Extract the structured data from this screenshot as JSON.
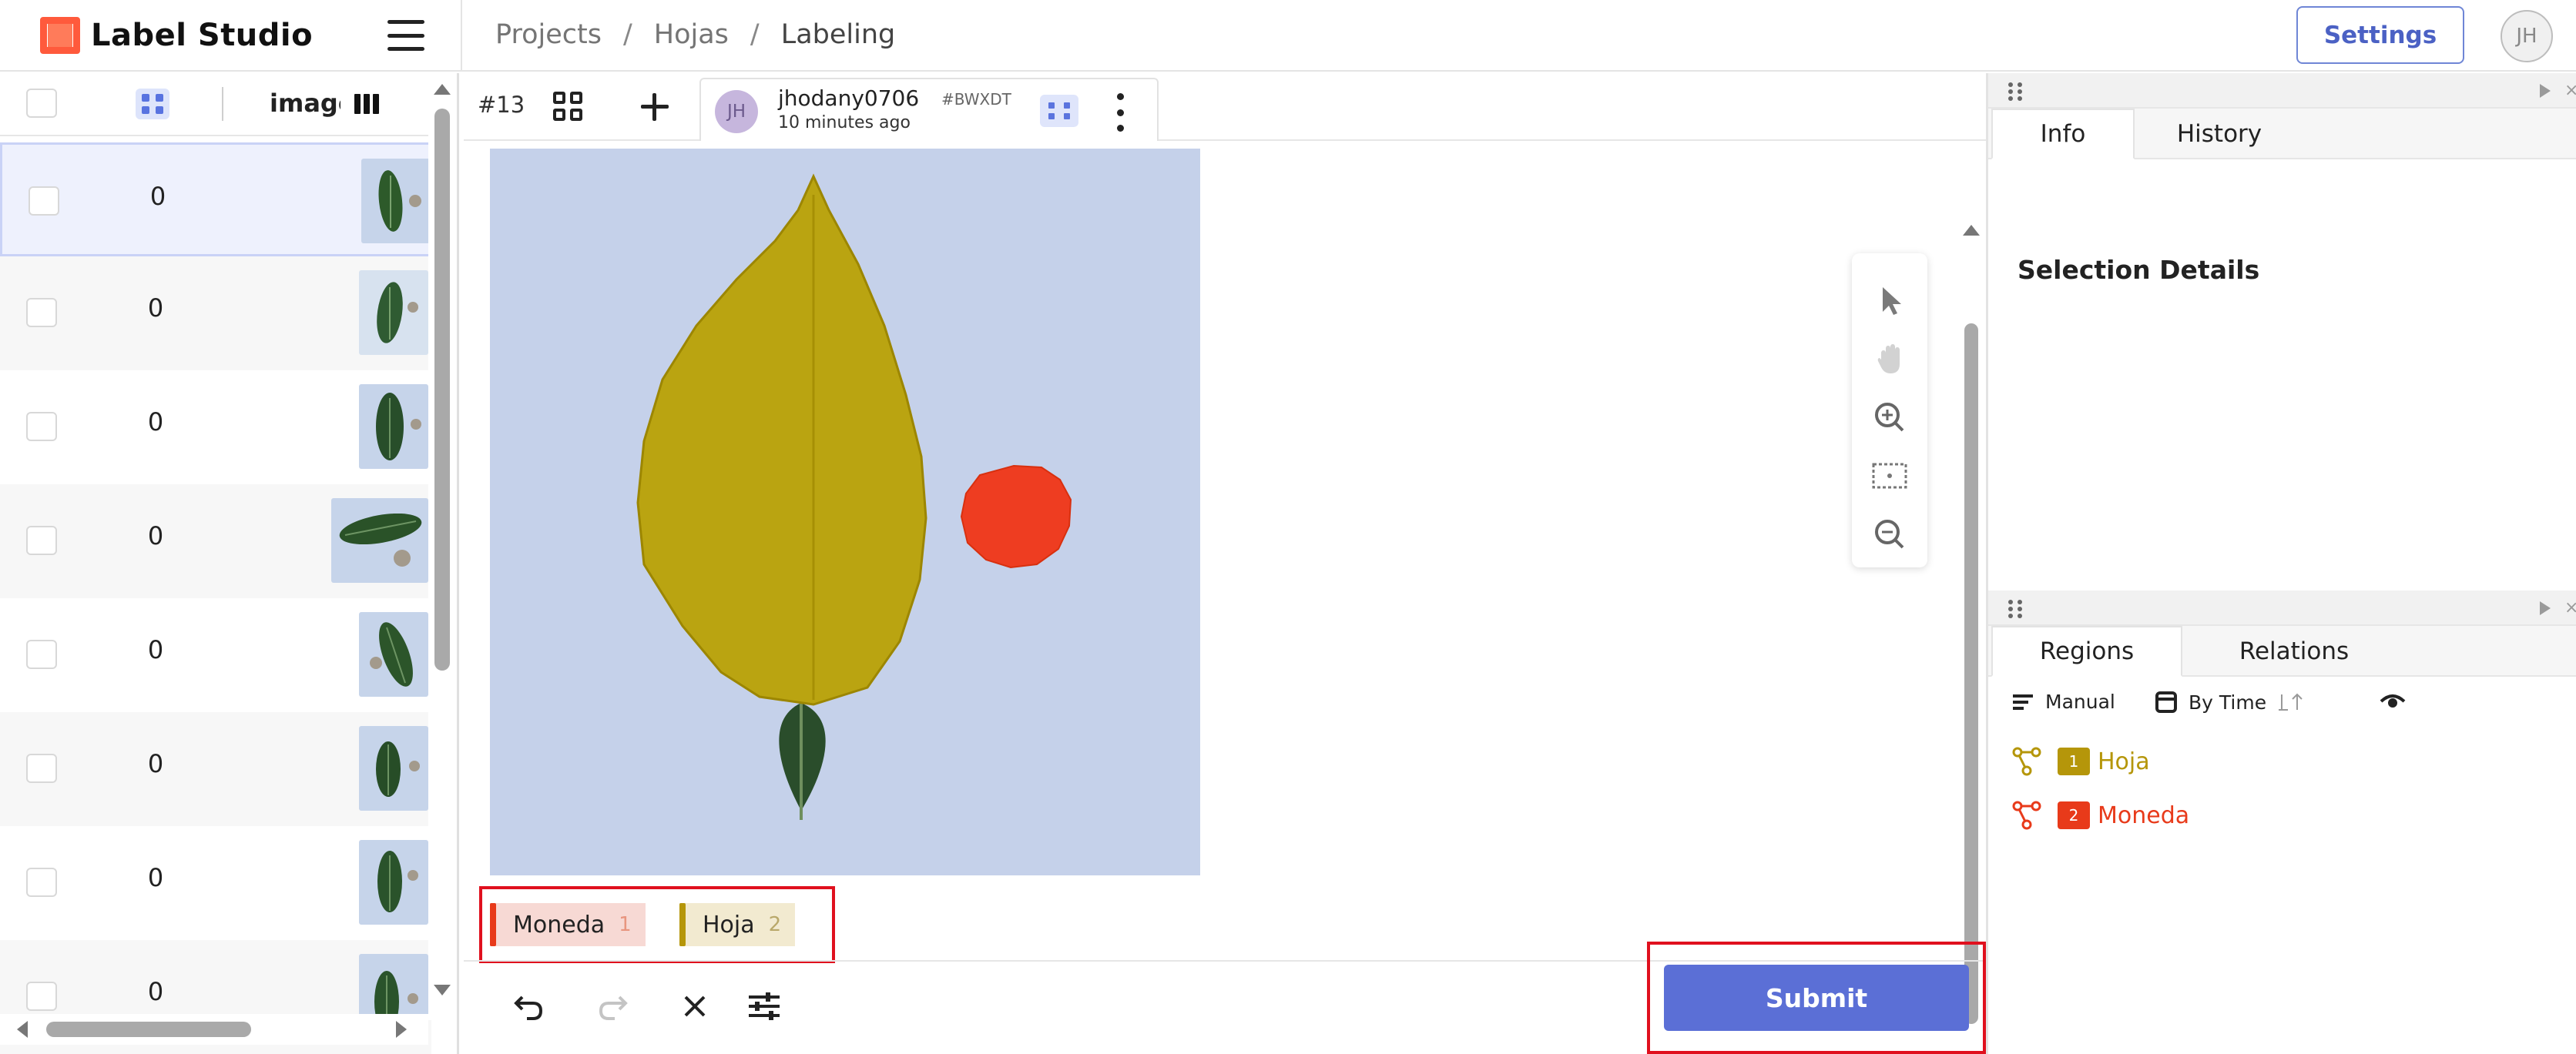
{
  "topbar": {
    "app_name": "Label Studio",
    "breadcrumb": [
      "Projects",
      "Hojas",
      "Labeling"
    ],
    "settings_label": "Settings",
    "user_initials": "JH"
  },
  "data_panel": {
    "column_header": "image",
    "rows": [
      {
        "value": "0",
        "selected": true
      },
      {
        "value": "0",
        "selected": false
      },
      {
        "value": "0",
        "selected": false
      },
      {
        "value": "0",
        "selected": false
      },
      {
        "value": "0",
        "selected": false
      },
      {
        "value": "0",
        "selected": false
      },
      {
        "value": "0",
        "selected": false
      },
      {
        "value": "0",
        "selected": false
      }
    ]
  },
  "annotation_bar": {
    "task_id": "#13",
    "annotator": {
      "initials": "JH",
      "username": "jhodany0706",
      "hash": "#BWXDT",
      "time": "10 minutes ago"
    }
  },
  "labels": [
    {
      "name": "Moneda",
      "hotkey": "1",
      "color": "#e83a1a",
      "bg": "#f7d9d4"
    },
    {
      "name": "Hoja",
      "hotkey": "2",
      "color": "#b5960a",
      "bg": "#f2ead0"
    }
  ],
  "submit_label": "Submit",
  "side_panel": {
    "top_tabs": [
      "Info",
      "History"
    ],
    "active_top_tab": "Info",
    "selection_title": "Selection Details",
    "bottom_tabs": [
      "Regions",
      "Relations"
    ],
    "active_bottom_tab": "Regions",
    "filters": {
      "manual": "Manual",
      "by_time": "By Time"
    },
    "regions": [
      {
        "index": "1",
        "label": "Hoja",
        "color": "#b5960a"
      },
      {
        "index": "2",
        "label": "Moneda",
        "color": "#e83a1a"
      }
    ]
  },
  "icons": {
    "tools": [
      "pointer-icon",
      "hand-icon",
      "zoom-in-icon",
      "fit-icon",
      "zoom-out-icon"
    ],
    "bottom": [
      "undo-icon",
      "redo-icon",
      "reset-icon",
      "settings-sliders-icon"
    ]
  },
  "colors": {
    "accent": "#5b6fd6",
    "highlight_box": "#e0101e",
    "canvas_bg": "#c5d1ea",
    "hoja_fill": "#b9a000",
    "moneda_fill": "#f0381a"
  }
}
